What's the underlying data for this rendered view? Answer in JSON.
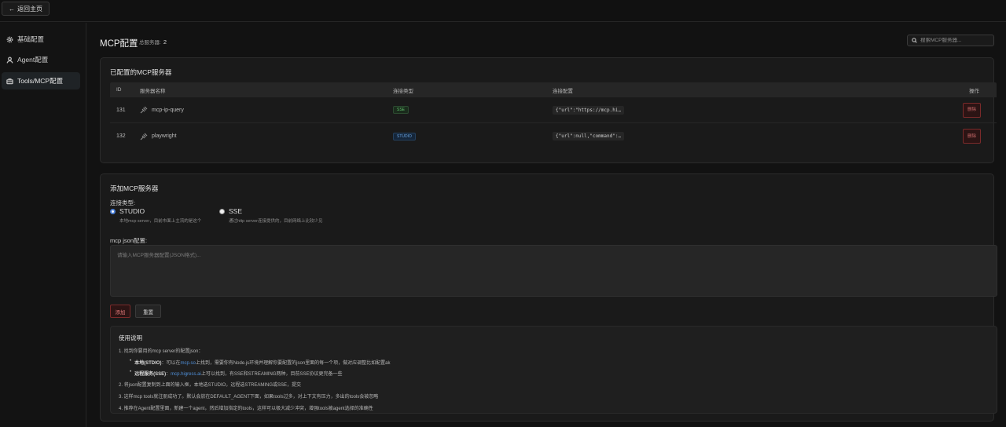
{
  "topbar": {
    "back_label": "返回主页"
  },
  "sidebar": {
    "items": [
      {
        "label": "基础配置",
        "icon": "gear-icon"
      },
      {
        "label": "Agent配置",
        "icon": "user-icon"
      },
      {
        "label": "Tools/MCP配置",
        "icon": "toolbox-icon",
        "active": true
      }
    ]
  },
  "header": {
    "title": "MCP配置",
    "total_label": "总服务器:",
    "total_count": "2",
    "search_placeholder": "搜索MCP服务器..."
  },
  "configured": {
    "title": "已配置的MCP服务器",
    "columns": {
      "id": "ID",
      "name": "服务器名称",
      "type": "连接类型",
      "config": "连接配置",
      "op": "操作"
    },
    "rows": [
      {
        "id": "131",
        "name": "mcp-ip-query",
        "type": "SSE",
        "config": "{\"url\":\"https://mcp.hi…",
        "delete": "删除"
      },
      {
        "id": "132",
        "name": "playwright",
        "type": "STUDIO",
        "config": "{\"url\":null,\"command\":…",
        "delete": "删除"
      }
    ]
  },
  "add": {
    "title": "添加MCP服务器",
    "conn_type_label": "连接类型:",
    "options": [
      {
        "title": "STUDIO",
        "desc": "本地mcp server，目前市面上主流的是这个",
        "checked": true
      },
      {
        "title": "SSE",
        "desc": "通过http server连接提供的，目前网络上比较少见",
        "checked": false
      }
    ],
    "json_label": "mcp json配置:",
    "json_placeholder": "请输入MCP服务器配置(JSON格式)...",
    "add_button": "添加",
    "reset_button": "重置"
  },
  "help": {
    "title": "使用说明",
    "line1": "1. 找到你要用的mcp server的配置json：",
    "sub1_bold": "本地(STDIO)",
    "sub1_pre": "：可以在",
    "sub1_link": "mcp.so",
    "sub1_post": "上找到，需要你有Node.js环境并理解你要配置的json里面的每一个项，做对应调整比如配置ak",
    "sub2_bold": "远程服务(SSE)",
    "sub2_pre": "：",
    "sub2_link": "mcp.higress.ai",
    "sub2_post": "上可以找到，有SSE和STREAMING两种，目前SSE协议更完备一些",
    "line2": "2. 将json配置复制到上面的输入框，本地选STUDIO，远程选STREAMING或SSE，提交",
    "line3": "3. 这样mcp tools就注册成功了。默认会放在DEFAULT_AGENT下面，如果tools过多，对上下文有压力，多出的tools会被忽略",
    "line4": "4. 推荐在Agent配置里面，新建一个agent，然后增加指定的tools，这样可以极大减少冲突，增强tools被agent选择的准确性"
  }
}
